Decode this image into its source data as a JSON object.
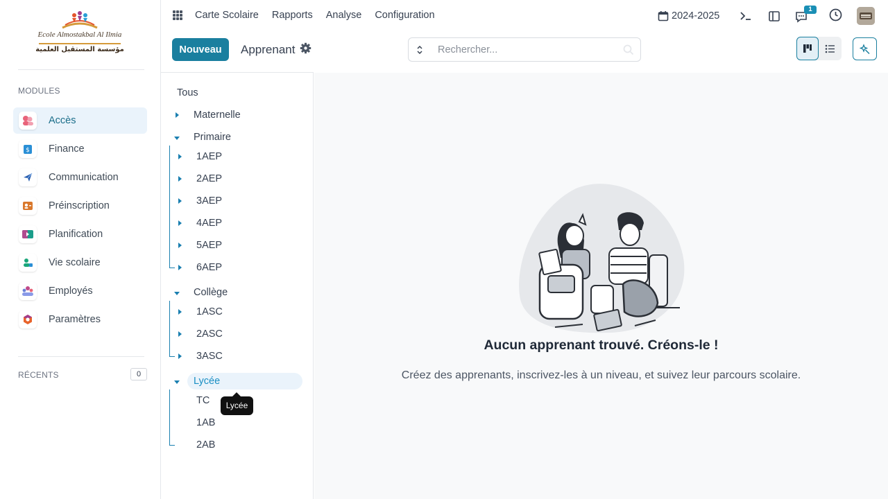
{
  "logo": {
    "line1": "Ecole Almostakbal Al Ilmia",
    "line2": "مؤسسة المستقبل العلمية"
  },
  "sidebar": {
    "modules_title": "MODULES",
    "modules": [
      {
        "label": "Accès",
        "icon": "users-icon",
        "active": true
      },
      {
        "label": "Finance",
        "icon": "finance-icon"
      },
      {
        "label": "Communication",
        "icon": "send-icon"
      },
      {
        "label": "Préinscription",
        "icon": "registration-icon"
      },
      {
        "label": "Planification",
        "icon": "planning-icon"
      },
      {
        "label": "Vie scolaire",
        "icon": "school-life-icon"
      },
      {
        "label": "Employés",
        "icon": "employees-icon"
      },
      {
        "label": "Paramètres",
        "icon": "settings-icon"
      }
    ],
    "recents_title": "RÉCENTS",
    "recents_count": "0"
  },
  "topbar": {
    "nav": [
      "Carte Scolaire",
      "Rapports",
      "Analyse",
      "Configuration"
    ],
    "year": "2024-2025",
    "messages_badge": "1"
  },
  "control": {
    "new_label": "Nouveau",
    "breadcrumb": "Apprenant",
    "search_placeholder": "Rechercher..."
  },
  "tree": {
    "all": "Tous",
    "maternelle": "Maternelle",
    "primaire": "Primaire",
    "primaire_children": [
      "1AEP",
      "2AEP",
      "3AEP",
      "4AEP",
      "5AEP",
      "6AEP"
    ],
    "college": "Collège",
    "college_children": [
      "1ASC",
      "2ASC",
      "3ASC"
    ],
    "lycee": "Lycée",
    "lycee_children": [
      "TC",
      "1AB",
      "2AB"
    ],
    "tooltip": "Lycée"
  },
  "empty": {
    "title": "Aucun apprenant trouvé. Créons-le !",
    "subtitle": "Créez des apprenants, inscrivez-les à un niveau, et suivez leur parcours scolaire."
  },
  "colors": {
    "accent": "#1a7f9f",
    "tree_line": "#1a7fb0",
    "active_bg": "#eaf3fb"
  }
}
